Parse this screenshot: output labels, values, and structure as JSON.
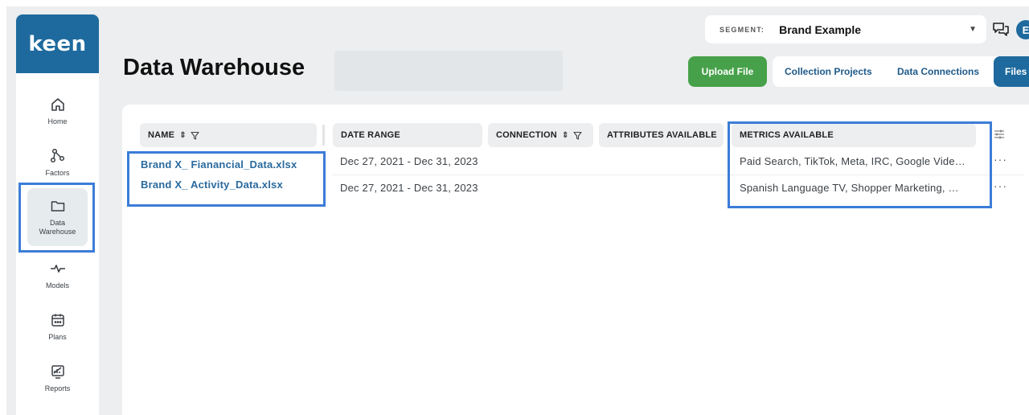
{
  "app": {
    "logo": "keen"
  },
  "sidebar": {
    "items": [
      {
        "label": "Home",
        "icon": "home-icon"
      },
      {
        "label": "Factors",
        "icon": "factors-icon"
      },
      {
        "label": "Data Warehouse",
        "icon": "folder-icon",
        "active": true
      },
      {
        "label": "Models",
        "icon": "pulse-icon"
      },
      {
        "label": "Plans",
        "icon": "calendar-icon"
      },
      {
        "label": "Reports",
        "icon": "report-icon"
      }
    ]
  },
  "header": {
    "title": "Data Warehouse",
    "segment_label": "SEGMENT:",
    "segment_value": "Brand Example",
    "avatar_initial": "E"
  },
  "actions": {
    "upload_label": "Upload File",
    "tabs": [
      "Collection Projects",
      "Data Connections",
      "Files"
    ]
  },
  "table": {
    "columns": [
      "NAME",
      "DATE RANGE",
      "CONNECTION",
      "ATTRIBUTES AVAILABLE",
      "METRICS AVAILABLE"
    ],
    "rows": [
      {
        "name": "Brand X_ Fianancial_Data.xlsx",
        "date_range": "Dec 27, 2021 - Dec 31, 2023",
        "connection": "",
        "attributes": "",
        "metrics": "Paid Search, TikTok, Meta, IRC, Google Vide…",
        "more": "···"
      },
      {
        "name": "Brand X_ Activity_Data.xlsx",
        "date_range": "Dec 27, 2021 - Dec 31, 2023",
        "connection": "",
        "attributes": "",
        "metrics": "Spanish Language TV, Shopper Marketing, …",
        "more": "···"
      }
    ]
  },
  "colors": {
    "brand_blue": "#1e6a9e",
    "upload_green": "#47a14a",
    "highlight_blue": "#3b7dd8",
    "link_blue": "#2a6a9e"
  }
}
